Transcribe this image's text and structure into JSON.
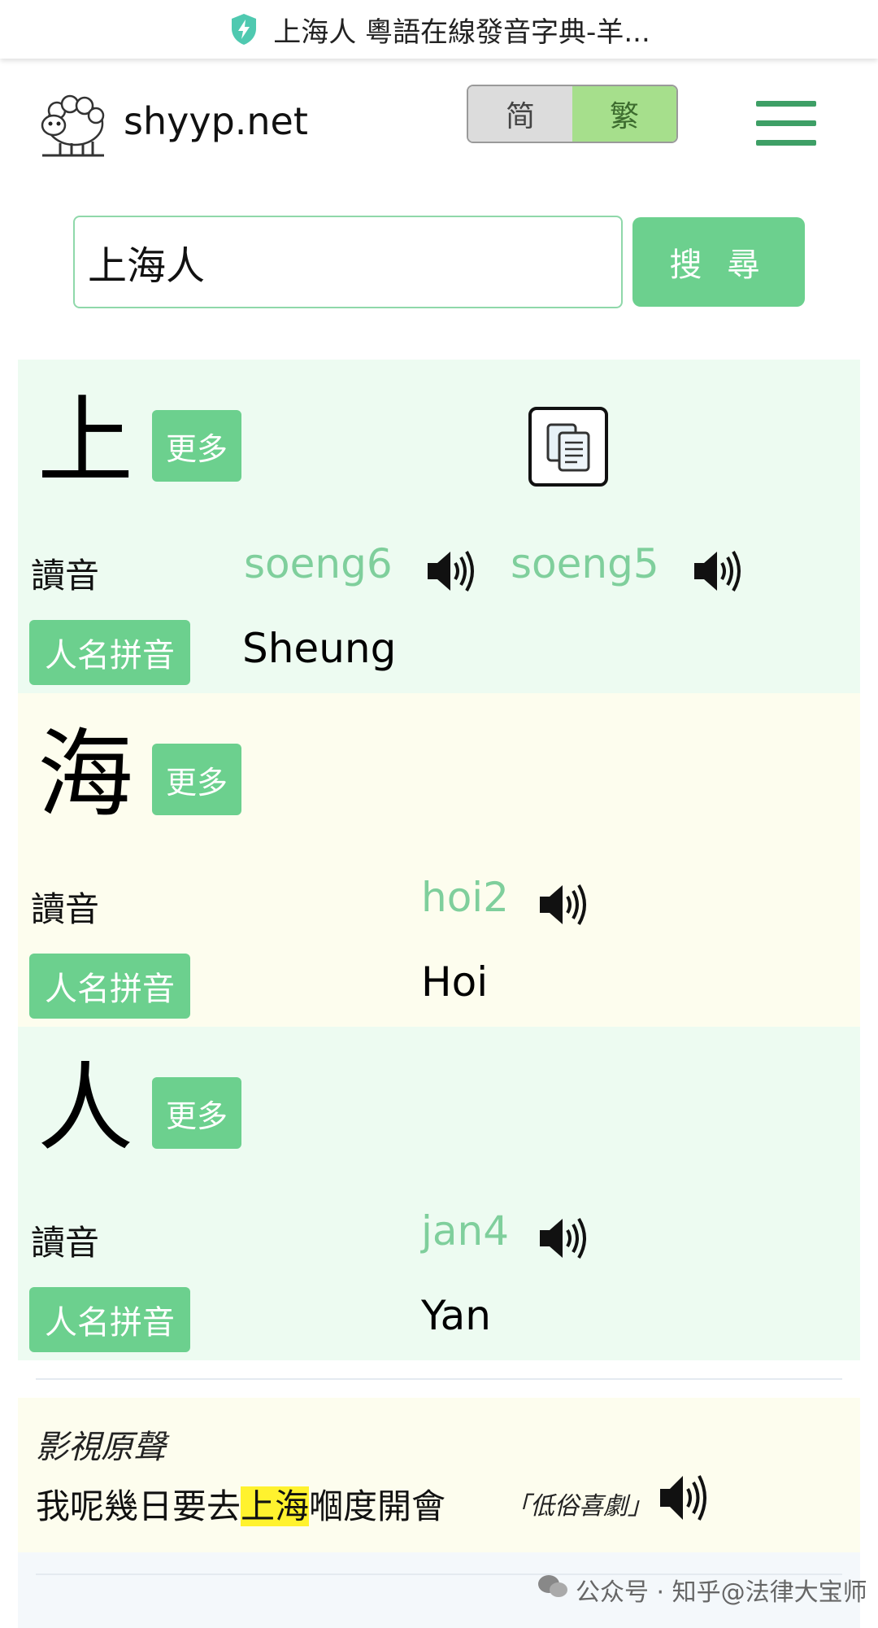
{
  "browser": {
    "tab_title": "上海人 粵語在線發音字典-羊..."
  },
  "header": {
    "site_name": "shyyp.net",
    "lang_simplified": "简",
    "lang_traditional": "繁"
  },
  "search": {
    "value": "上海人",
    "button_label": "搜 尋"
  },
  "labels": {
    "more": "更多",
    "reading": "讀音",
    "name_pinyin": "人名拼音"
  },
  "characters": [
    {
      "char": "上",
      "readings": [
        "soeng6",
        "soeng5"
      ],
      "name_romanization": "Sheung"
    },
    {
      "char": "海",
      "readings": [
        "hoi2"
      ],
      "name_romanization": "Hoi"
    },
    {
      "char": "人",
      "readings": [
        "jan4"
      ],
      "name_romanization": "Yan"
    }
  ],
  "film_quote": {
    "title": "影視原聲",
    "text_before": "我呢幾日要去",
    "text_highlight": "上海",
    "text_after": "嗰度開會",
    "source": "「低俗喜劇」"
  },
  "watermark": "公众号 · 知乎@法律大宝师",
  "colors": {
    "accent_green": "#6cd08e",
    "reading_green": "#7fcf9c",
    "block_green_bg": "#edfbf1",
    "block_cream_bg": "#fdfdee",
    "highlight": "#fff22e"
  }
}
